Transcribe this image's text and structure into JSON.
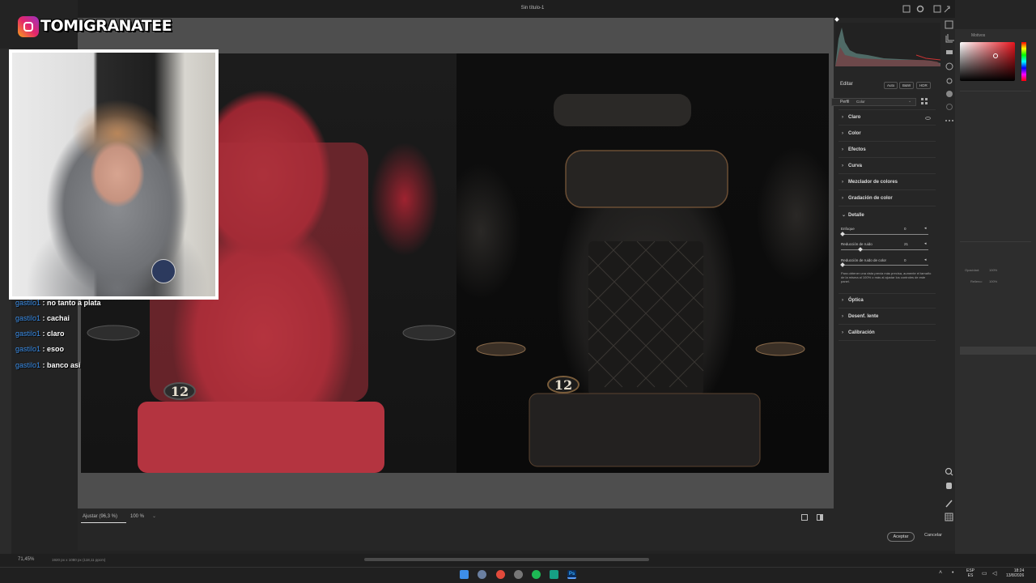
{
  "overlay": {
    "handle": "TOMIGRANATEE",
    "chat": [
      {
        "user": "gastilo1",
        "message": "no tanto a plata"
      },
      {
        "user": "gastilo1",
        "message": "cachai"
      },
      {
        "user": "gastilo1",
        "message": "claro"
      },
      {
        "user": "gastilo1",
        "message": "esoo"
      },
      {
        "user": "gastilo1",
        "message": "banco asi"
      }
    ]
  },
  "dialog": {
    "title": "Sin título-1",
    "canvas": {
      "fit_label": "Ajustar (96,3 %)",
      "zoom": "100 %",
      "seat_number_left": "12",
      "seat_number_right": "12"
    },
    "edit_panel": {
      "header": "Editar",
      "modes": [
        "Auto",
        "B&W",
        "HDR"
      ],
      "profile_label": "Perfil",
      "profile_value": "Color",
      "sections_top": [
        "Claro",
        "Color",
        "Efectos",
        "Curva",
        "Mezclador de colores",
        "Gradación de color"
      ],
      "detail": {
        "title": "Detalle",
        "sliders": [
          {
            "label": "Enfoque",
            "value": "0",
            "fraction": 0.0
          },
          {
            "label": "Reducción de ruido",
            "value": "21",
            "fraction": 0.21
          },
          {
            "label": "Reducción de ruido de color",
            "value": "0",
            "fraction": 0.0
          }
        ],
        "note": "Para obtener una vista previa más precisa, aumente el tamaño de la misma al 100% o más al ajustar los controles de este panel."
      },
      "sections_bottom": [
        "Óptica",
        "Desenf. lente",
        "Calibración"
      ]
    },
    "buttons": {
      "accept": "Aceptar",
      "cancel": "Cancelar"
    }
  },
  "photoshop": {
    "zoom": "71,45%",
    "doc_size": "1920 px x 1080 px (118,11 ppcm)",
    "panel_tab": "Motivos",
    "properties": {
      "opacity_label": "Opacidad:",
      "opacity_value": "100%",
      "fill_label": "Relleno:",
      "fill_value": "100%"
    }
  },
  "taskbar": {
    "lang_line1": "ESP",
    "lang_line2": "ES",
    "time": "18:24",
    "date": "13/8/2026"
  },
  "colors": {
    "accent_blue": "#3b8ee8",
    "seat_red": "#b0343d",
    "ig_gradient": "#e4266a"
  }
}
